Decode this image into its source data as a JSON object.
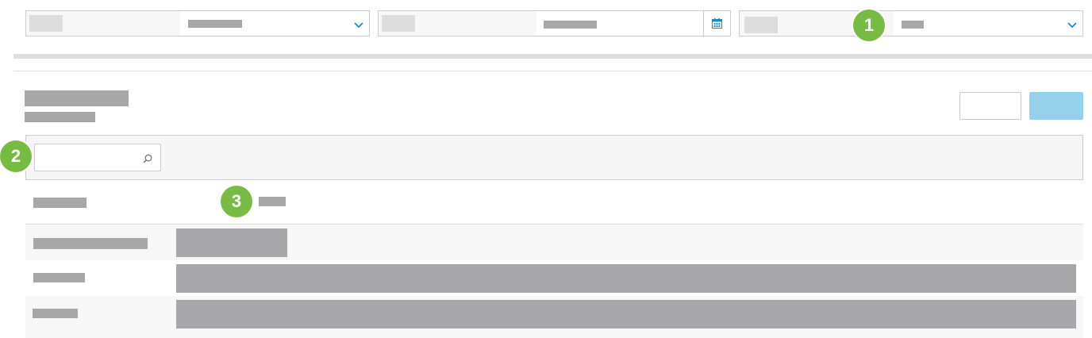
{
  "badges": [
    "1",
    "2",
    "3"
  ],
  "colors": {
    "badge_green": "#77bb44",
    "primary_button": "#96d0ea",
    "placeholder_bar": "#a7a7a9",
    "calendar_icon": "#1a8cc4",
    "chevron_icon": "#1a8cc4"
  },
  "icons": {
    "filter_1": "chevron-down-icon",
    "filter_2": "calendar-icon",
    "filter_3": "chevron-down-icon",
    "search": "search-icon"
  }
}
